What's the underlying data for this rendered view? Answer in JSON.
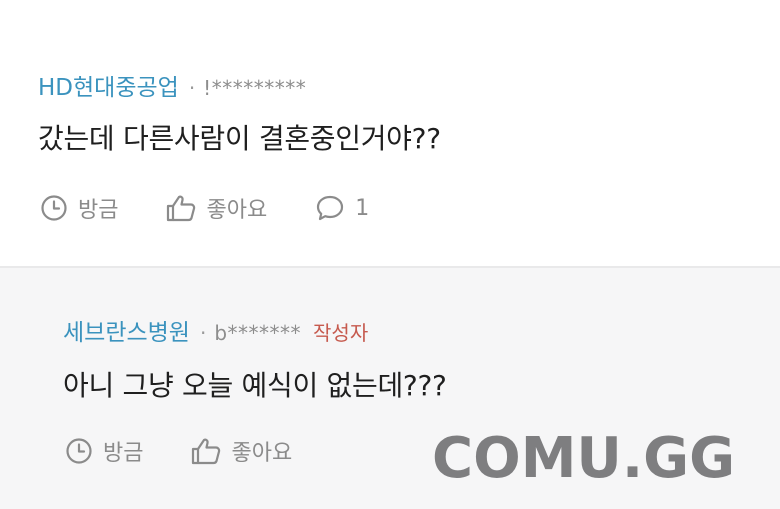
{
  "comment": {
    "company": "HD현대중공업",
    "separator": "·",
    "author": "!*********",
    "text": "갔는데 다른사람이 결혼중인거야??",
    "time": "방금",
    "like_label": "좋아요",
    "reply_count": "1"
  },
  "reply": {
    "company": "세브란스병원",
    "separator": "·",
    "author": "b*******",
    "op_badge": "작성자",
    "text": "아니 그냥 오늘 예식이 없는데???",
    "time": "방금",
    "like_label": "좋아요"
  },
  "watermark": "COMU.GG",
  "colors": {
    "company": "#3b93be",
    "op_badge": "#c65a4e",
    "reply_bg": "#f6f6f7",
    "icon": "#8b8b8b"
  },
  "icons": [
    "clock-icon",
    "thumbs-up-icon",
    "speech-bubble-icon"
  ]
}
